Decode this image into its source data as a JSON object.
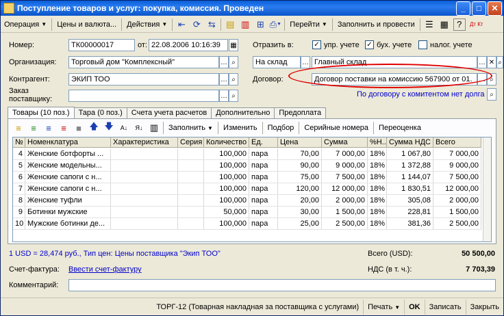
{
  "window": {
    "title": "Поступление товаров и услуг: покупка, комиссия. Проведен",
    "minimize": "_",
    "maximize": "□",
    "close": "✕"
  },
  "toolbar": {
    "operation": "Операция",
    "prices": "Цены и валюта...",
    "actions": "Действия",
    "goto": "Перейти",
    "fill_post": "Заполнить и провести",
    "help": "?",
    "dtkt": "Дт Кт"
  },
  "form": {
    "number_label": "Номер:",
    "number": "ТК00000017",
    "date_label": "от:",
    "date": "22.08.2006 10:16:39",
    "org_label": "Организация:",
    "org": "Торговый дом \"Комплексный\"",
    "contractor_label": "Контрагент:",
    "contractor": "ЭКИП ТОО",
    "order_label_1": "Заказ",
    "order_label_2": "поставщику:",
    "order": "",
    "reflect_label": "Отразить в:",
    "upr": "упр. учете",
    "buh": "бух. учете",
    "nalog": "налог. учете",
    "upr_checked": "✓",
    "buh_checked": "✓",
    "stock_type": "На склад",
    "warehouse": "Главный склад",
    "contract_label": "Договор:",
    "contract": "Договор поставки на комиссию 567900 от 01.",
    "commission_link": "По договору с комитентом нет долга"
  },
  "tabs": [
    "Товары (10 поз.)",
    "Тара (0 поз.)",
    "Счета учета расчетов",
    "Дополнительно",
    "Предоплата"
  ],
  "grid_toolbar": {
    "fill": "Заполнить",
    "change": "Изменить",
    "select": "Подбор",
    "serial": "Серийные номера",
    "reval": "Переоценка"
  },
  "table": {
    "headers": [
      "№",
      "Номенклатура",
      "Характеристика",
      "Серия",
      "Количество",
      "Ед.",
      "Цена",
      "Сумма",
      "%Н...",
      "Сумма НДС",
      "Всего"
    ],
    "rows": [
      [
        "4",
        "Женские ботфорты ...",
        "",
        "",
        "100,000",
        "пара",
        "70,00",
        "7 000,00",
        "18%",
        "1 067,80",
        "7 000,00"
      ],
      [
        "5",
        "Женские модельны...",
        "",
        "",
        "100,000",
        "пара",
        "90,00",
        "9 000,00",
        "18%",
        "1 372,88",
        "9 000,00"
      ],
      [
        "6",
        "Женские сапоги с н...",
        "",
        "",
        "100,000",
        "пара",
        "75,00",
        "7 500,00",
        "18%",
        "1 144,07",
        "7 500,00"
      ],
      [
        "7",
        "Женские сапоги с н...",
        "",
        "",
        "100,000",
        "пара",
        "120,00",
        "12 000,00",
        "18%",
        "1 830,51",
        "12 000,00"
      ],
      [
        "8",
        "Женские туфли",
        "",
        "",
        "100,000",
        "пара",
        "20,00",
        "2 000,00",
        "18%",
        "305,08",
        "2 000,00"
      ],
      [
        "9",
        "Ботинки мужские",
        "",
        "",
        "50,000",
        "пара",
        "30,00",
        "1 500,00",
        "18%",
        "228,81",
        "1 500,00"
      ],
      [
        "10",
        "Мужские ботинки де...",
        "",
        "",
        "100,000",
        "пара",
        "25,00",
        "2 500,00",
        "18%",
        "381,36",
        "2 500,00"
      ]
    ]
  },
  "summary": {
    "rate_link": "1 USD = 28,474 руб., Тип цен: Цены поставщика \"Экип ТОО\"",
    "total_label": "Всего (USD):",
    "total": "50 500,00",
    "vat_label": "НДС (в т. ч.):",
    "vat": "7 703,39",
    "invoice_label": "Счет-фактура:",
    "invoice_link": "Ввести счет-фактуру",
    "comment_label": "Комментарий:",
    "comment": ""
  },
  "bottom": {
    "torg": "ТОРГ-12 (Товарная накладная за поставщика с услугами)",
    "print": "Печать",
    "ok": "OK",
    "save": "Записать",
    "close": "Закрыть"
  }
}
